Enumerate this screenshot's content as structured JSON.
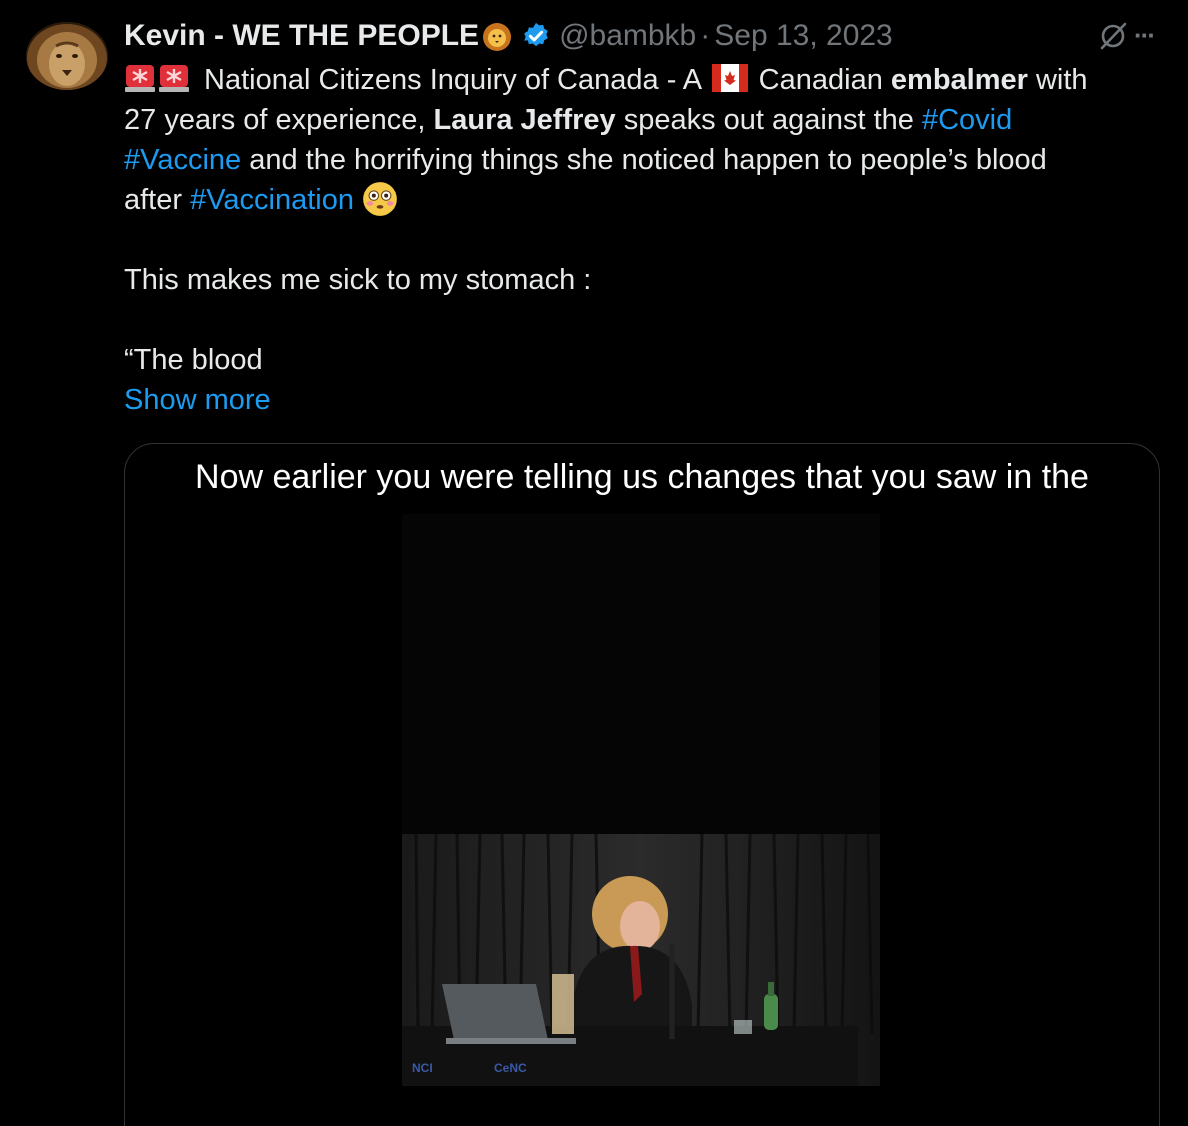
{
  "tweet": {
    "display_name": "Kevin - WE THE PEOPLE",
    "handle": "@bambkb",
    "separator": "·",
    "date": "Sep 13, 2023",
    "more_icon": "···",
    "text": {
      "l1_a": " National Citizens Inquiry of Canada - A ",
      "l1_b": " Canadian ",
      "l1_bold": "embalmer",
      "l1_c": " with",
      "l2_a": "27 years of experience, ",
      "l2_bold": "Laura Jeffrey",
      "l2_b": " speaks out against the ",
      "l2_link": "#Covid",
      "l3_link": "#Vaccine",
      "l3_a": " and the horrifying things she noticed happen to people’s blood",
      "l4_a": "after ",
      "l4_link": "#Vaccination",
      "p2": "This makes me sick to my stomach :",
      "p3": "“The blood",
      "show_more": "Show more"
    },
    "media": {
      "caption": "Now earlier you were telling us changes that you saw in the",
      "logo_text_1": "NCI",
      "logo_text_2": "CeNC"
    }
  },
  "icons": [
    "lion-emoji",
    "verified-badge-icon",
    "grok-icon",
    "more-icon",
    "siren-emoji",
    "canada-flag-emoji",
    "flushed-face-emoji"
  ],
  "colors": {
    "background": "#000000",
    "text": "#e7e9ea",
    "secondary": "#71767b",
    "link": "#1d9bf0",
    "border": "#2f3336"
  }
}
